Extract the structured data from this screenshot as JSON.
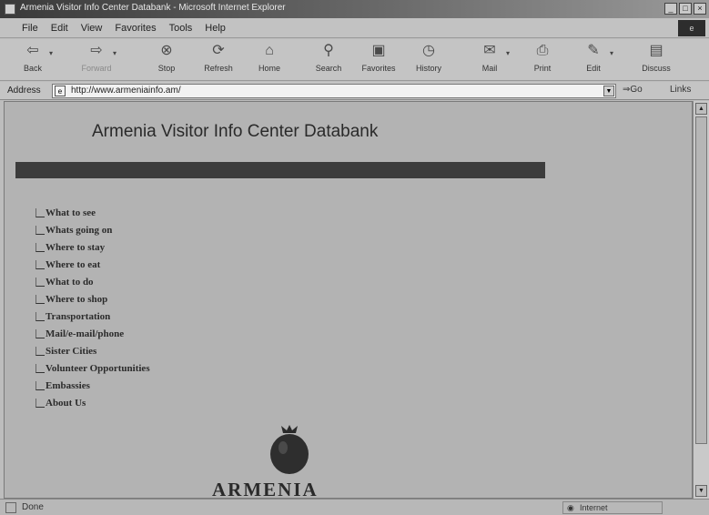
{
  "window": {
    "title": "Armenia Visitor Info Center Databank - Microsoft Internet Explorer"
  },
  "menu": [
    "File",
    "Edit",
    "View",
    "Favorites",
    "Tools",
    "Help"
  ],
  "toolbar": {
    "back": "Back",
    "forward": "Forward",
    "stop": "Stop",
    "refresh": "Refresh",
    "home": "Home",
    "search": "Search",
    "favorites": "Favorites",
    "history": "History",
    "mail": "Mail",
    "print": "Print",
    "edit": "Edit",
    "discuss": "Discuss"
  },
  "address": {
    "label": "Address",
    "url": "http://www.armeniainfo.am/",
    "go": "Go",
    "links": "Links"
  },
  "page": {
    "heading": "Armenia Visitor Info Center Databank",
    "nav": [
      "What to see",
      "Whats going on",
      "Where to stay",
      "Where to eat",
      "What to do",
      "Where to shop",
      "Transportation",
      "Mail/e-mail/phone",
      "Sister Cities",
      "Volunteer Opportunities",
      "Embassies",
      "About Us"
    ],
    "logo_text": "ARMENIA"
  },
  "status": {
    "text": "Done",
    "zone": "Internet"
  },
  "colors": {
    "page_bg": "#b3b3b3",
    "rule": "#3c3c3c"
  }
}
